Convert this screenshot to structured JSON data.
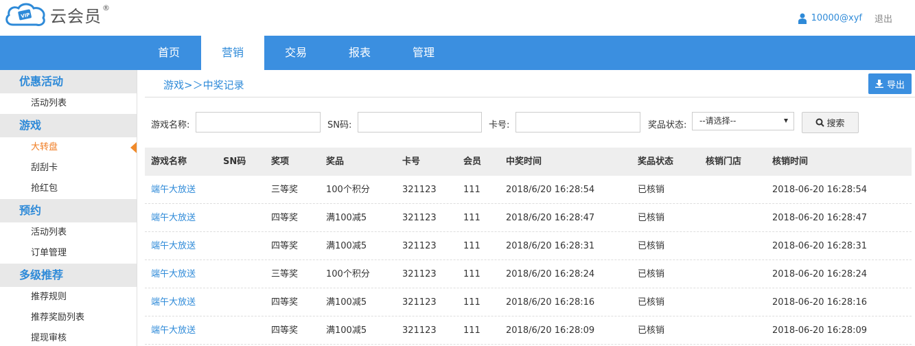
{
  "brand": {
    "name": "云会员",
    "reg": "®",
    "badge": "VIP"
  },
  "user": {
    "name": "10000@xyf",
    "logout": "退出"
  },
  "nav": [
    {
      "label": "首页",
      "active": false
    },
    {
      "label": "营销",
      "active": true
    },
    {
      "label": "交易",
      "active": false
    },
    {
      "label": "报表",
      "active": false
    },
    {
      "label": "管理",
      "active": false
    }
  ],
  "sidebar": {
    "groups": [
      {
        "title": "优惠活动",
        "items": [
          "活动列表"
        ]
      },
      {
        "title": "游戏",
        "items": [
          "大转盘",
          "刮刮卡",
          "抢红包"
        ]
      },
      {
        "title": "预约",
        "items": [
          "活动列表",
          "订单管理"
        ]
      },
      {
        "title": "多级推荐",
        "items": [
          "推荐规则",
          "推荐奖励列表",
          "提现审核"
        ]
      }
    ],
    "active_item": "大转盘"
  },
  "breadcrumb": "游戏>＞中奖记录",
  "export_label": "导出",
  "search": {
    "game_name_label": "游戏名称:",
    "sn_label": "SN码:",
    "card_label": "卡号:",
    "status_label": "奖品状态:",
    "status_value": "--请选择--",
    "search_label": "搜索"
  },
  "table": {
    "columns": [
      "游戏名称",
      "SN码",
      "奖项",
      "奖品",
      "卡号",
      "会员",
      "中奖时间",
      "奖品状态",
      "核销门店",
      "核销时间"
    ],
    "rows": [
      [
        "端午大放送",
        "",
        "三等奖",
        "100个积分",
        "321123",
        "111",
        "2018/6/20 16:28:54",
        "已核销",
        "",
        "2018-06-20 16:28:54"
      ],
      [
        "端午大放送",
        "",
        "四等奖",
        "满100减5",
        "321123",
        "111",
        "2018/6/20 16:28:47",
        "已核销",
        "",
        "2018-06-20 16:28:47"
      ],
      [
        "端午大放送",
        "",
        "四等奖",
        "满100减5",
        "321123",
        "111",
        "2018/6/20 16:28:31",
        "已核销",
        "",
        "2018-06-20 16:28:31"
      ],
      [
        "端午大放送",
        "",
        "三等奖",
        "100个积分",
        "321123",
        "111",
        "2018/6/20 16:28:24",
        "已核销",
        "",
        "2018-06-20 16:28:24"
      ],
      [
        "端午大放送",
        "",
        "四等奖",
        "满100减5",
        "321123",
        "111",
        "2018/6/20 16:28:16",
        "已核销",
        "",
        "2018-06-20 16:28:16"
      ],
      [
        "端午大放送",
        "",
        "四等奖",
        "满100减5",
        "321123",
        "111",
        "2018/6/20 16:28:09",
        "已核销",
        "",
        "2018-06-20 16:28:09"
      ]
    ]
  }
}
